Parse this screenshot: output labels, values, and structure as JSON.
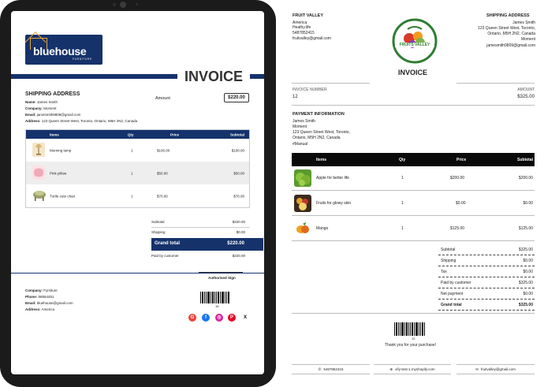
{
  "left_invoice": {
    "logo": {
      "brand": "bluehouse",
      "tagline": "FURNITURE"
    },
    "title": "INVOICE",
    "shipping_heading": "SHIPPING ADDRESS",
    "name_label": "Name:",
    "name": "James Smith",
    "company_label": "Company:",
    "company": "Moment",
    "email_label": "Email:",
    "email": "jamesmith9809@gmail.com",
    "address_label": "Address:",
    "address": "123 Queen Street West, Toronto, Ontario, M5H 2N2, Canada",
    "amount_label": "Amount",
    "amount_value": "$220.00",
    "table": {
      "headers": {
        "items": "Items",
        "qty": "Qty",
        "price": "Price",
        "subtotal": "Subtotal"
      },
      "rows": [
        {
          "name": "Morning lamp",
          "qty": "1",
          "price": "$100.00",
          "subtotal": "$100.00"
        },
        {
          "name": "Pink pillow",
          "qty": "1",
          "price": "$50.00",
          "subtotal": "$50.00"
        },
        {
          "name": "Turtle cute chair",
          "qty": "1",
          "price": "$70.00",
          "subtotal": "$70.00"
        }
      ]
    },
    "summary": {
      "subtotal_label": "Subtotal",
      "subtotal": "$220.00",
      "shipping_label": "Shipping",
      "shipping": "$0.00",
      "grand_label": "Grand total",
      "grand": "$220.00",
      "paid_label": "Paid by customer",
      "paid": "$220.00"
    },
    "sign_label": "Authorised Sign",
    "footer": {
      "company_label": "Company:",
      "company": "Fymiture",
      "phone_label": "Phone:",
      "phone": "58564451",
      "email_label": "Email:",
      "email": "bluehouse@gmail.com",
      "address_label": "Address:",
      "address": "America"
    },
    "barcode_number": "16",
    "social": [
      "G",
      "f",
      "◎",
      "P",
      "X"
    ],
    "colors": {
      "navy": "#15326b"
    }
  },
  "right_invoice": {
    "store_name": "FRUIT VALLEY",
    "store_lines": [
      "America",
      "Heathy.life",
      "5487852415",
      "fruitvalley@gmail.com"
    ],
    "logo_text": "FRUITS VALLEY",
    "shipping_heading": "SHIPPING ADDRESS",
    "shipping_lines": [
      "James Smith",
      "123 Queen Street West, Toronto,",
      "Ontario, M5H 2N2, Canada",
      "Moment",
      "jamesmith9809@gmail.com"
    ],
    "title": "INVOICE",
    "invoice_number_label": "INVOICE NUMBER",
    "invoice_number": "12",
    "amount_label": "AMOUNT",
    "amount": "$325.00",
    "payment_heading": "PAYMENT INFORMATION",
    "payment_lines": [
      "James Smith",
      "Moment",
      "123 Queen Street West, Toronto,",
      "Ontario, M5H 2N2, Canada",
      "#Manual"
    ],
    "table": {
      "headers": {
        "items": "Items",
        "qty": "Qty",
        "price": "Price",
        "subtotal": "Subtotal"
      },
      "rows": [
        {
          "name": "Apple for better life",
          "qty": "1",
          "price": "$200.00",
          "subtotal": "$200.00"
        },
        {
          "name": "Fruits for glowy skin",
          "qty": "1",
          "price": "$0.00",
          "subtotal": "$0.00"
        },
        {
          "name": "Mango",
          "qty": "1",
          "price": "$125.00",
          "subtotal": "$125.00"
        }
      ]
    },
    "summary": [
      {
        "label": "Subtotal",
        "value": "$325.00",
        "bold": false
      },
      {
        "label": "Shipping",
        "value": "$0.00",
        "bold": false
      },
      {
        "label": "Tax",
        "value": "$0.00",
        "bold": false
      },
      {
        "label": "Paid by customer",
        "value": "$325.00",
        "bold": false
      },
      {
        "label": "Net payment",
        "value": "$0.00",
        "bold": false
      },
      {
        "label": "Grand total",
        "value": "$325.00",
        "bold": true
      }
    ],
    "barcode_number": "12",
    "thank_you": "Thank you for your purchase!",
    "footer": {
      "phone": "5487852415",
      "site": "xify-test-1.myshopify.com",
      "email": "fruitvalley@gmail.com"
    }
  }
}
